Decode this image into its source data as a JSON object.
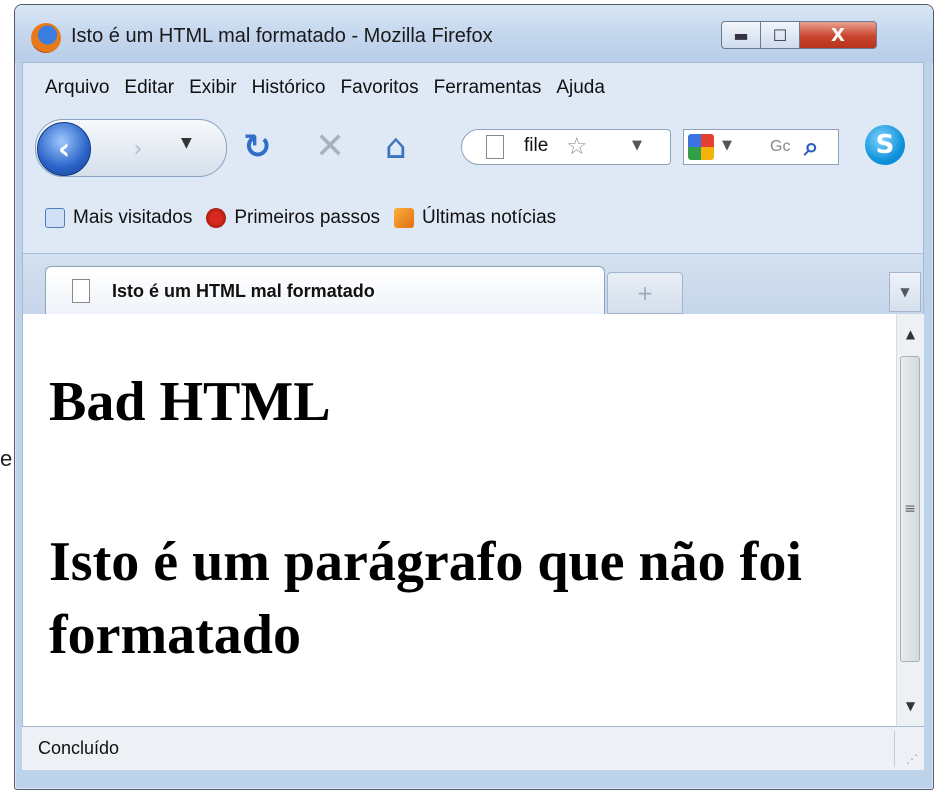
{
  "window": {
    "title": "Isto é um HTML mal formatado - Mozilla Firefox",
    "minimize_glyph": "▬",
    "maximize_glyph": "☐",
    "close_glyph": "X"
  },
  "menu": [
    "Arquivo",
    "Editar",
    "Exibir",
    "Histórico",
    "Favoritos",
    "Ferramentas",
    "Ajuda"
  ],
  "nav": {
    "url": "file",
    "search_placeholder": "Gc",
    "icons": [
      "back-icon",
      "forward-icon",
      "reload-icon",
      "stop-icon",
      "home-icon",
      "star-icon",
      "google-icon",
      "search-icon",
      "skype-icon"
    ]
  },
  "bookmarks": [
    "Mais visitados",
    "Primeiros passos",
    "Últimas notícias"
  ],
  "tab": {
    "label": "Isto é um HTML mal formatado",
    "new_tab_glyph": "+"
  },
  "page": {
    "heading": "Bad HTML",
    "paragraph": "Isto é um parágrafo que não foi formatado"
  },
  "status": {
    "text": "Concluído"
  },
  "side_mark": "e"
}
